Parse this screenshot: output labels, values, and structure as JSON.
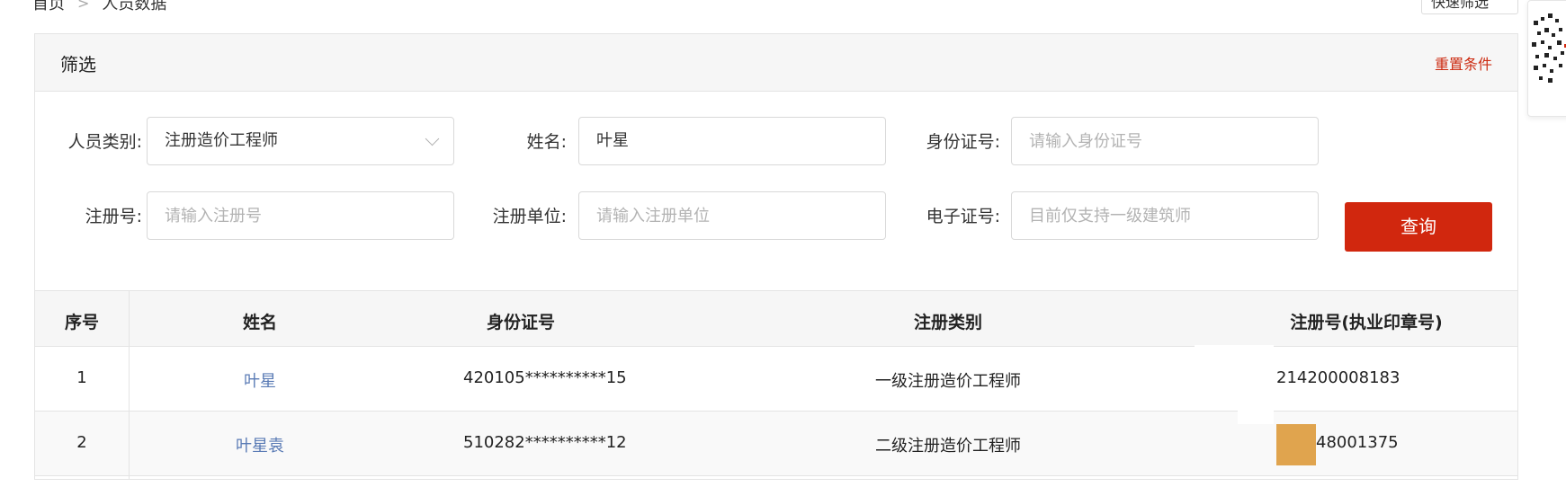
{
  "breadcrumb": {
    "home": "首页",
    "separator": ">",
    "current": "人员数据"
  },
  "top_select": {
    "label": "快速筛选"
  },
  "filter": {
    "title": "筛选",
    "reset_label": "重置条件",
    "fields": {
      "person_type": {
        "label": "人员类别:",
        "value": "注册造价工程师"
      },
      "name": {
        "label": "姓名:",
        "value": "叶星"
      },
      "id_number": {
        "label": "身份证号:",
        "placeholder": "请输入身份证号"
      },
      "reg_number": {
        "label": "注册号:",
        "placeholder": "请输入注册号"
      },
      "reg_unit": {
        "label": "注册单位:",
        "placeholder": "请输入注册单位"
      },
      "e_cert": {
        "label": "电子证号:",
        "placeholder": "目前仅支持一级建筑师"
      }
    },
    "query_label": "查询"
  },
  "table": {
    "headers": [
      "序号",
      "姓名",
      "身份证号",
      "注册类别",
      "注册号(执业印章号)"
    ],
    "rows": [
      {
        "index": "1",
        "name": "叶星",
        "id": "420105**********15",
        "category": "一级注册造价工程师",
        "reg_no": "214200008183"
      },
      {
        "index": "2",
        "name": "叶星袁",
        "id": "510282**********12",
        "category": "二级注册造价工程师",
        "reg_no": "48001375"
      }
    ]
  },
  "colors": {
    "accent": "#d1270e",
    "link": "#5a7bb5",
    "redaction": "#e0a44e"
  },
  "icons": {
    "dropdown": "chevron-down-icon",
    "qr": "qr-code-icon"
  }
}
